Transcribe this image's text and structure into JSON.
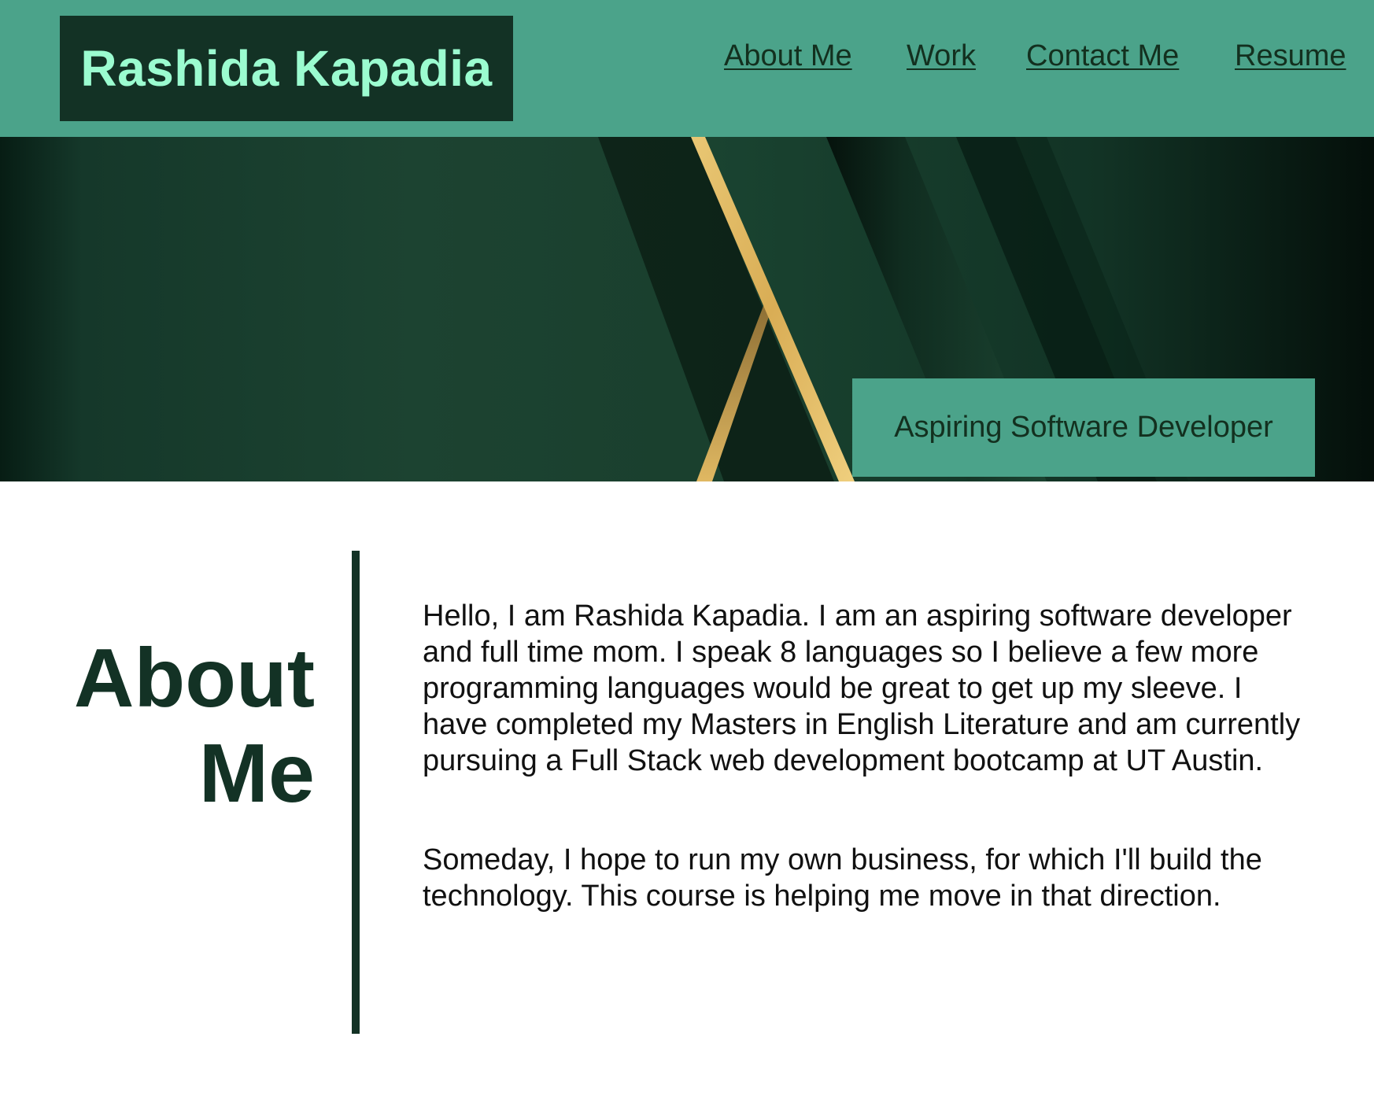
{
  "header": {
    "brand": "Rashida Kapadia",
    "nav": {
      "about": "About Me",
      "work": "Work",
      "contact": "Contact Me",
      "resume": "Resume"
    }
  },
  "hero": {
    "tagline": "Aspiring Software Developer"
  },
  "about": {
    "heading_line1": "About",
    "heading_line2": "Me",
    "paragraph1": "Hello, I am Rashida Kapadia. I am an aspiring software developer and full time mom. I speak 8 languages so I believe a few more programming languages would be great to get up my sleeve. I have completed my Masters in English Literature and am currently pursuing a Full Stack web development bootcamp at UT Austin.",
    "paragraph2": "Someday, I hope to run my own business, for which I'll build the technology. This course is helping me move in that direction."
  },
  "colors": {
    "header_bg": "#4ba38a",
    "brand_bg": "#133225",
    "brand_text": "#9bfcd0",
    "hero_green": "#1a3f2d",
    "gold_stripe": "#e3bd65",
    "accent_dark": "#133225"
  }
}
